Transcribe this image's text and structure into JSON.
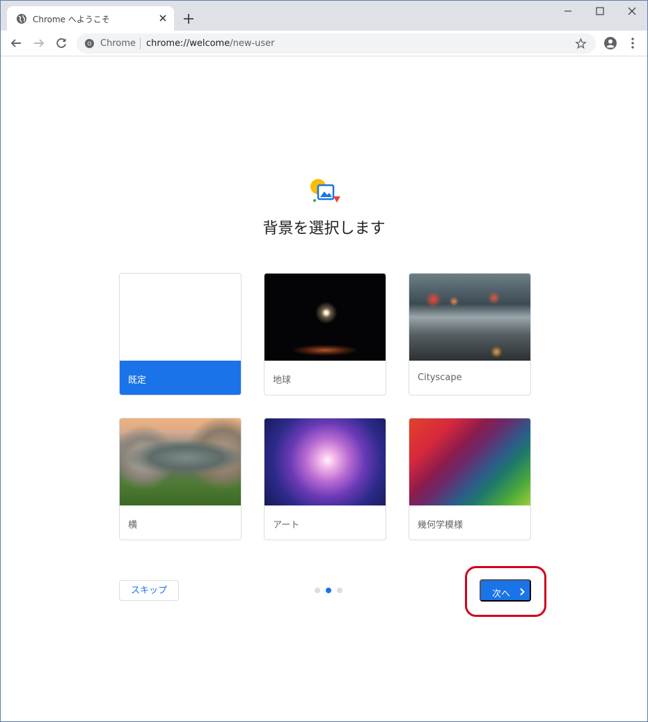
{
  "tab": {
    "title": "Chrome へようこそ",
    "favicon": "globe-icon"
  },
  "omnibox": {
    "chip": "Chrome",
    "url_host": "chrome://welcome",
    "url_path": "/new-user"
  },
  "content": {
    "heading": "背景を選択します",
    "backgrounds": [
      {
        "label": "既定",
        "selected": true
      },
      {
        "label": "地球",
        "selected": false
      },
      {
        "label": "Cityscape",
        "selected": false
      },
      {
        "label": "横",
        "selected": false
      },
      {
        "label": "アート",
        "selected": false
      },
      {
        "label": "幾何学模様",
        "selected": false
      }
    ]
  },
  "footer": {
    "skip_label": "スキップ",
    "next_label": "次へ",
    "page_current": 2,
    "page_total": 3
  },
  "colors": {
    "accent": "#1a73e8",
    "highlight": "#d0021b"
  }
}
